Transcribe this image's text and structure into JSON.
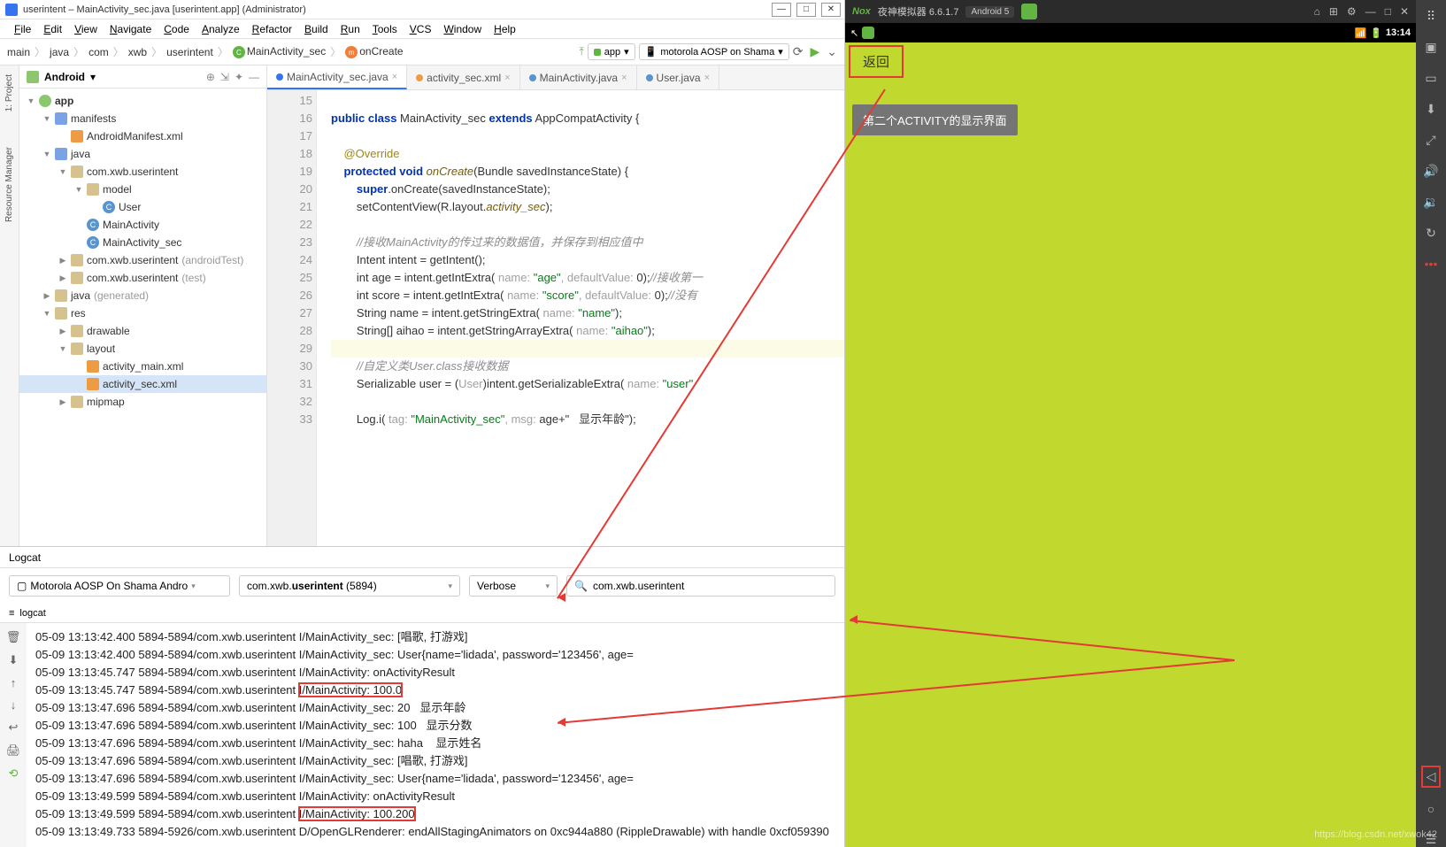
{
  "titlebar": {
    "text": "userintent – MainActivity_sec.java [userintent.app] (Administrator)"
  },
  "menu": [
    "File",
    "Edit",
    "View",
    "Navigate",
    "Code",
    "Analyze",
    "Refactor",
    "Build",
    "Run",
    "Tools",
    "VCS",
    "Window",
    "Help"
  ],
  "breadcrumb": [
    "main",
    "java",
    "com",
    "xwb",
    "userintent",
    "MainActivity_sec",
    "onCreate"
  ],
  "runcfg": "app",
  "device": "motorola AOSP on Shama",
  "project": {
    "variant": "Android",
    "rows": [
      {
        "d": 0,
        "a": "▼",
        "i": "mod",
        "t": "app",
        "b": true
      },
      {
        "d": 1,
        "a": "▼",
        "i": "folder-blue",
        "t": "manifests"
      },
      {
        "d": 2,
        "a": "",
        "i": "xml",
        "t": "AndroidManifest.xml"
      },
      {
        "d": 1,
        "a": "▼",
        "i": "folder-blue",
        "t": "java"
      },
      {
        "d": 2,
        "a": "▼",
        "i": "folder",
        "t": "com.xwb.userintent"
      },
      {
        "d": 3,
        "a": "▼",
        "i": "folder",
        "t": "model"
      },
      {
        "d": 4,
        "a": "",
        "i": "class",
        "t": "User"
      },
      {
        "d": 3,
        "a": "",
        "i": "class",
        "t": "MainActivity"
      },
      {
        "d": 3,
        "a": "",
        "i": "class",
        "t": "MainActivity_sec"
      },
      {
        "d": 2,
        "a": "▶",
        "i": "folder",
        "t": "com.xwb.userintent",
        "m": "(androidTest)"
      },
      {
        "d": 2,
        "a": "▶",
        "i": "folder",
        "t": "com.xwb.userintent",
        "m": "(test)"
      },
      {
        "d": 1,
        "a": "▶",
        "i": "folder",
        "t": "java",
        "m": "(generated)"
      },
      {
        "d": 1,
        "a": "▼",
        "i": "folder",
        "t": "res"
      },
      {
        "d": 2,
        "a": "▶",
        "i": "folder",
        "t": "drawable"
      },
      {
        "d": 2,
        "a": "▼",
        "i": "folder",
        "t": "layout"
      },
      {
        "d": 3,
        "a": "",
        "i": "xml",
        "t": "activity_main.xml"
      },
      {
        "d": 3,
        "a": "",
        "i": "xml",
        "t": "activity_sec.xml",
        "sel": true
      },
      {
        "d": 2,
        "a": "▶",
        "i": "folder",
        "t": "mipmap"
      }
    ]
  },
  "tabs": [
    {
      "icon": "blue",
      "label": "MainActivity_sec.java",
      "active": true
    },
    {
      "icon": "orange",
      "label": "activity_sec.xml"
    },
    {
      "icon": "green",
      "label": "MainActivity.java"
    },
    {
      "icon": "green",
      "label": "User.java"
    }
  ],
  "lines_start": 15,
  "lines_end": 33,
  "logcat": {
    "title": "Logcat",
    "device": "Motorola AOSP On Shama Andro",
    "process": "com.xwb.userintent (5894)",
    "level": "Verbose",
    "filter": "com.xwb.userintent",
    "tablabel": "logcat",
    "lines": [
      "05-09 13:13:42.400 5894-5894/com.xwb.userintent I/MainActivity_sec: [唱歌, 打游戏]",
      "05-09 13:13:42.400 5894-5894/com.xwb.userintent I/MainActivity_sec: User{name='lidada', password='123456', age=",
      "05-09 13:13:45.747 5894-5894/com.xwb.userintent I/MainActivity: onActivityResult",
      "05-09 13:13:45.747 5894-5894/com.xwb.userintent I/MainActivity: 100.0",
      "05-09 13:13:47.696 5894-5894/com.xwb.userintent I/MainActivity_sec: 20   显示年龄",
      "05-09 13:13:47.696 5894-5894/com.xwb.userintent I/MainActivity_sec: 100   显示分数",
      "05-09 13:13:47.696 5894-5894/com.xwb.userintent I/MainActivity_sec: haha    显示姓名",
      "05-09 13:13:47.696 5894-5894/com.xwb.userintent I/MainActivity_sec: [唱歌, 打游戏]",
      "05-09 13:13:47.696 5894-5894/com.xwb.userintent I/MainActivity_sec: User{name='lidada', password='123456', age=",
      "05-09 13:13:49.599 5894-5894/com.xwb.userintent I/MainActivity: onActivityResult",
      "05-09 13:13:49.599 5894-5894/com.xwb.userintent I/MainActivity: 100.200",
      "05-09 13:13:49.733 5894-5926/com.xwb.userintent D/OpenGLRenderer: endAllStagingAnimators on 0xc944a880 (RippleDrawable) with handle 0xcf059390"
    ],
    "hl": [
      3,
      10
    ]
  },
  "emu": {
    "title": "夜神模拟器 6.6.1.7",
    "android": "Android 5",
    "clock": "13:14",
    "backLabel": "返回",
    "badge": "第二个ACTIVITY的显示界面"
  },
  "watermark": "https://blog.csdn.net/xwok42",
  "code": {
    "l16": "public class MainActivity_sec extends AppCompatActivity {",
    "l18": "    @Override",
    "l19": "    protected void onCreate(Bundle savedInstanceState) {",
    "l20": "        super.onCreate(savedInstanceState);",
    "l21_a": "        setContentView(R.layout.",
    "l21_b": "activity_sec",
    "l21_c": ");",
    "l23": "        //接收MainActivity的传过来的数据值，并保存到相应值中",
    "l24": "        Intent intent = getIntent();",
    "l25_a": "        int age = intent.getIntExtra( ",
    "l25_n": "name: ",
    "l25_s": "\"age\"",
    "l25_d": ", defaultValue: ",
    "l25_v": "0",
    "l25_e": ");",
    "l25_c": "//接收第一",
    "l26_a": "        int score = intent.getIntExtra( ",
    "l26_s": "\"score\"",
    "l26_c": "//没有",
    "l27_a": "        String name = intent.getStringExtra( ",
    "l27_s": "\"name\"",
    "l27_e": ");",
    "l28_a": "        String[] aihao = intent.getStringArrayExtra( ",
    "l28_s": "\"aihao\"",
    "l28_e": ");",
    "l30": "        //自定义类User.class接收数据",
    "l31_a": "        Serializable user = (",
    "l31_u": "User",
    "l31_b": ")intent.getSerializableExtra( ",
    "l31_s": "\"user\"",
    "l33_a": "        Log.i( ",
    "l33_t": "tag: ",
    "l33_s": "\"MainActivity_sec\"",
    "l33_m": ", msg: ",
    "l33_v": "age+\"   显示年龄\"",
    "l33_e": ");"
  }
}
